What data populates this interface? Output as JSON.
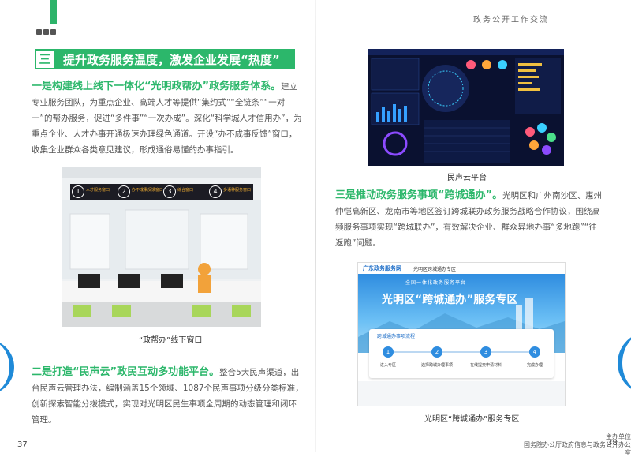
{
  "header_right": "政务公开工作交流",
  "section": {
    "number": "三",
    "title": "提升政务服务温度，激发企业发展“热度”"
  },
  "para1": {
    "lead": "一是构建线上线下一体化“光明政帮办”政务服务体系。",
    "body": "建立专业服务团队，为重点企业、高端人才等提供“集约式”“全链条”“一对一”的帮办服务，促进“多件事”“一次办成”。深化“科学城人才信用办”，为重点企业、人才办事开通极速办理绿色通道。开设“办不成事反馈”窗口，收集企业群众各类意见建议，形成通俗易懂的办事指引。"
  },
  "photo": {
    "counters": [
      {
        "num": "1",
        "label": "人才服务窗口"
      },
      {
        "num": "2",
        "label": "办不成事反馈窗口"
      },
      {
        "num": "3",
        "label": "综合窗口"
      },
      {
        "num": "4",
        "label": "多语种服务窗口"
      }
    ]
  },
  "caption1": "“政帮办”线下窗口",
  "para2": {
    "lead": "二是打造“民声云”政民互动多功能平台。",
    "body": "整合5大民声渠道，出台民声云管理办法，编制涵盖15个领域、1087个民声事项分级分类标准，创新探索智能分拨模式，实现对光明区民生事项全周期的动态管理和闭环管理。"
  },
  "caption2": "民声云平台",
  "para3": {
    "lead": "三是推动政务服务事项“跨城通办”。",
    "body": "光明区和广州南沙区、惠州仲恺高新区、龙南市等地区签订跨城联办政务服务战略合作协议，围绕高频服务事项实现“跨城联办”，有效解决企业、群众异地办事“多地跑”“往返跑”问题。"
  },
  "screenshot": {
    "logo": "广东政务服务网",
    "tab": "光明区跨城通办专区",
    "banner_top": "全国一体化政务服务平台",
    "banner_title": "光明区“跨城通办”服务专区",
    "flow_title": "跨城通办事项流程",
    "steps": [
      "进入专区",
      "选择跨城办理事项",
      "在线提交申请材料",
      "完成办理"
    ]
  },
  "caption3": "光明区“跨城通办”服务专区",
  "page_left": "37",
  "page_right": "38",
  "footer": {
    "line1": "主办单位",
    "line2": "国务院办公厅政府信息与政务公开办公室"
  },
  "colors": {
    "accent_green": "#2cb76b",
    "accent_blue": "#1f8ad8"
  }
}
